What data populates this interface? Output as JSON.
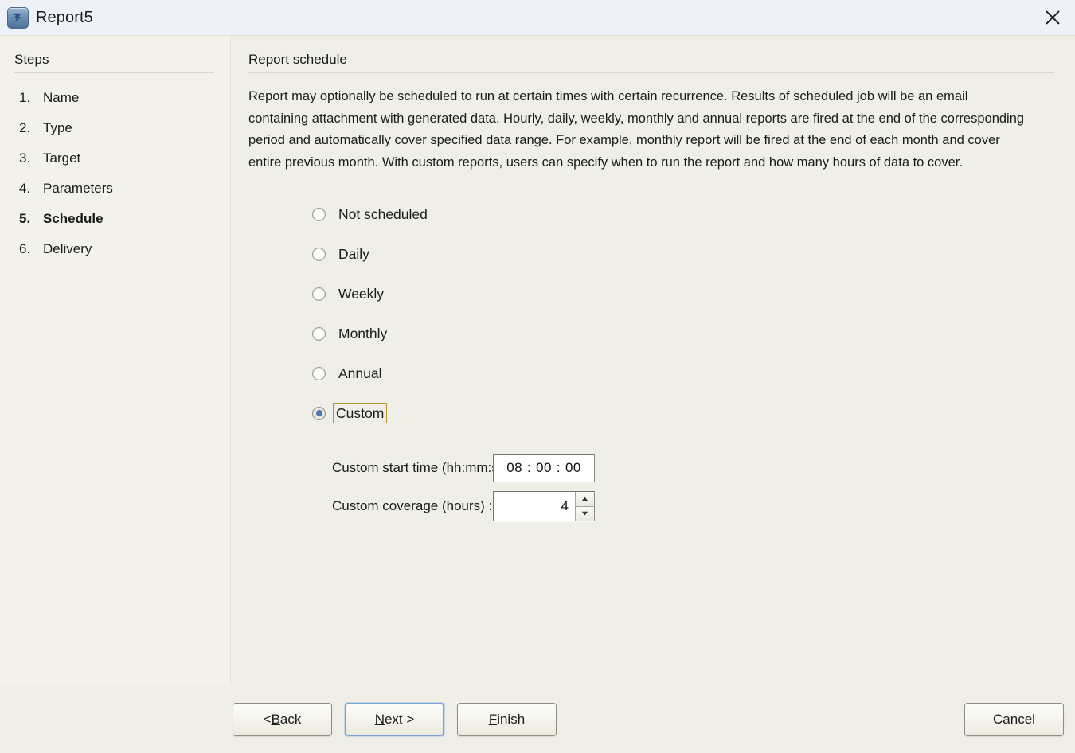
{
  "window": {
    "title": "Report5",
    "icon": "report-app-icon",
    "close_icon": "close-icon"
  },
  "sidebar": {
    "heading": "Steps",
    "items": [
      {
        "num": "1.",
        "label": "Name",
        "active": false
      },
      {
        "num": "2.",
        "label": "Type",
        "active": false
      },
      {
        "num": "3.",
        "label": "Target",
        "active": false
      },
      {
        "num": "4.",
        "label": "Parameters",
        "active": false
      },
      {
        "num": "5.",
        "label": "Schedule",
        "active": true
      },
      {
        "num": "6.",
        "label": "Delivery",
        "active": false
      }
    ]
  },
  "main": {
    "heading": "Report schedule",
    "description": "Report may optionally be scheduled to run at certain times with certain recurrence. Results of scheduled job will be an email containing attachment with generated data. Hourly, daily, weekly, monthly and annual reports are fired at the end of the corresponding period and automatically cover specified data range. For example, monthly report will be fired at the end of each month and cover entire previous month. With custom reports, users can specify when to run the report and how many hours of data to cover.",
    "schedule_options": [
      {
        "label": "Not scheduled",
        "selected": false
      },
      {
        "label": "Daily",
        "selected": false
      },
      {
        "label": "Weekly",
        "selected": false
      },
      {
        "label": "Monthly",
        "selected": false
      },
      {
        "label": "Annual",
        "selected": false
      },
      {
        "label": "Custom",
        "selected": true
      }
    ],
    "custom_start_time": {
      "label": "Custom start time (hh:mm:ss) :",
      "hours": "08",
      "minutes": "00",
      "seconds": "00",
      "separator": ":"
    },
    "custom_coverage": {
      "label": "Custom coverage (hours) :",
      "value": "4"
    }
  },
  "footer": {
    "back": {
      "prefix": "< ",
      "mnemonic": "B",
      "suffix": "ack"
    },
    "next": {
      "prefix": "",
      "mnemonic": "N",
      "suffix": "ext >"
    },
    "finish": {
      "prefix": "",
      "mnemonic": "F",
      "suffix": "inish"
    },
    "cancel": {
      "label": "Cancel"
    }
  },
  "colors": {
    "titlebar": "#eef1f7",
    "content_bg": "#f0efe7",
    "sidebar_bg": "#f3f2ea",
    "focus_ring": "#b8942f",
    "default_button_border": "#7da2cc",
    "radio_selected": "#4a78b5"
  }
}
